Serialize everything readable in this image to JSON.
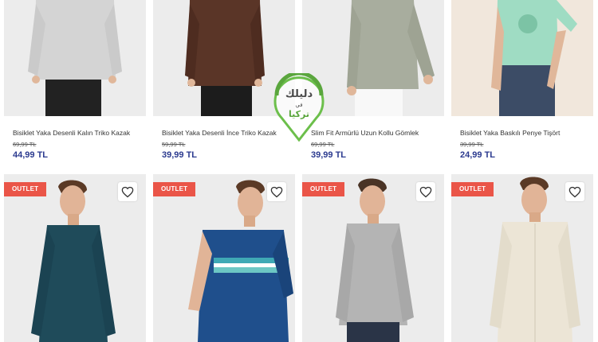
{
  "products_top": [
    {
      "title": "Bisiklet Yaka Desenli Kalın Triko Kazak",
      "old_price": "69,99 TL",
      "price": "44,99 TL",
      "top_color": "#d4d4d4",
      "bg": "#ececec"
    },
    {
      "title": "Bisiklet Yaka Desenli İnce Triko Kazak",
      "old_price": "59,99 TL",
      "price": "39,99 TL",
      "top_color": "#5a3527",
      "bg": "#ececec"
    },
    {
      "title": "Slim Fit Armürlü Uzun Kollu Gömlek",
      "old_price": "69,99 TL",
      "price": "39,99 TL",
      "top_color": "#a8ad9e",
      "bg": "#ececec"
    },
    {
      "title": "Bisiklet Yaka Baskılı Penye Tişört",
      "old_price": "39,99 TL",
      "price": "24,99 TL",
      "top_color": "#9fdcc3",
      "bg": "#f1e7dc"
    }
  ],
  "products_bottom": [
    {
      "badge": "OUTLET",
      "top_color": "#1f4b5a",
      "bg": "#ececec"
    },
    {
      "badge": "OUTLET",
      "top_color": "#1f4f8c",
      "bg": "#ececec"
    },
    {
      "badge": "OUTLET",
      "top_color": "#b4b4b4",
      "bg": "#ececec"
    },
    {
      "badge": "OUTLET",
      "top_color": "#ece5d6",
      "bg": "#ececec"
    }
  ],
  "watermark": {
    "line1": "دليلك",
    "line2": "في",
    "line3": "تركيا"
  },
  "colors": {
    "price": "#2b3a8f",
    "outlet": "#ea5548",
    "watermark_green": "#6cbf4b"
  }
}
